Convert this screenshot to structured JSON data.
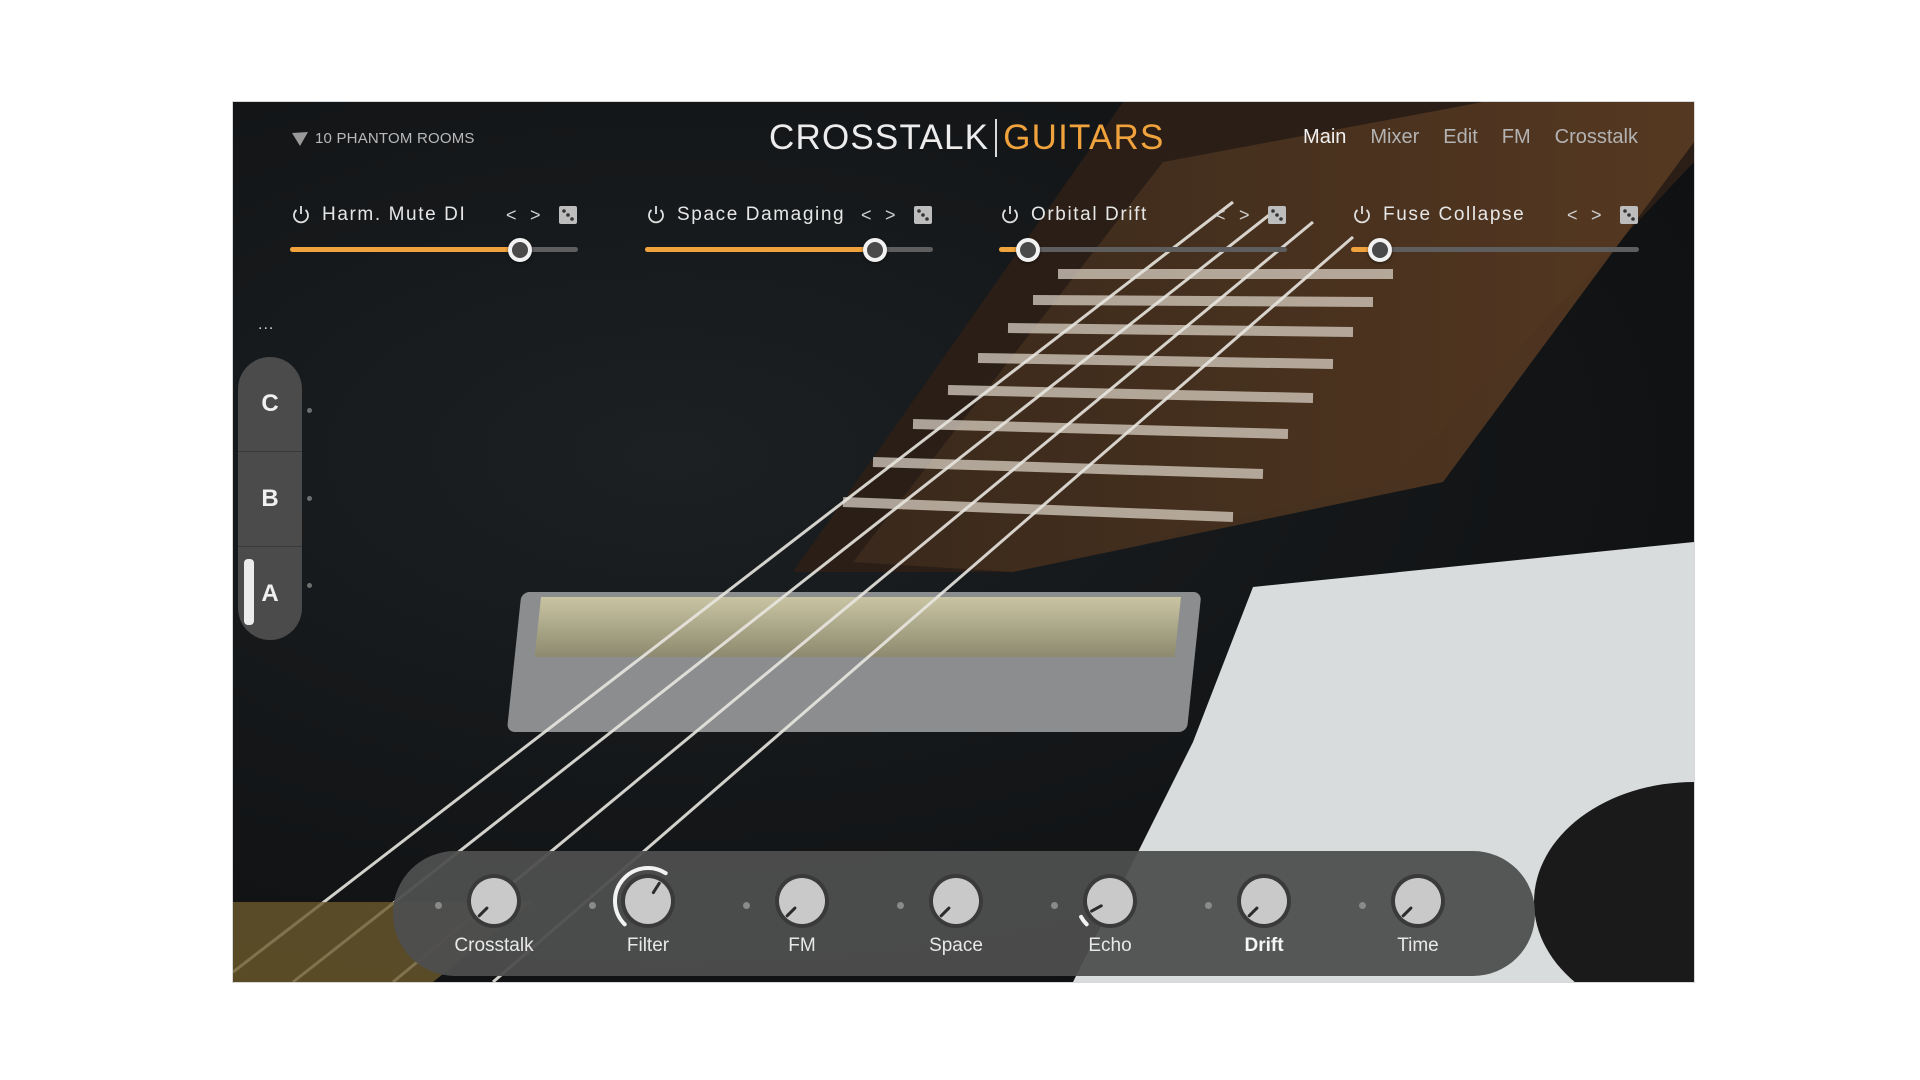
{
  "brand": {
    "logo_icon": "phantom-logo-icon",
    "name": "10 PHANTOM ROOMS"
  },
  "title": {
    "part1": "CROSSTALK",
    "part2": "GUITARS",
    "accent": "#f0a23c"
  },
  "nav": [
    {
      "label": "Main",
      "active": true
    },
    {
      "label": "Mixer",
      "active": false
    },
    {
      "label": "Edit",
      "active": false
    },
    {
      "label": "FM",
      "active": false
    },
    {
      "label": "Crosstalk",
      "active": false
    }
  ],
  "slots": [
    {
      "name": "Harm. Mute DI",
      "value": 0.8,
      "prev": "<",
      "next": ">"
    },
    {
      "name": "Space Damaging",
      "value": 0.8,
      "prev": "<",
      "next": ">"
    },
    {
      "name": "Orbital Drift",
      "value": 0.1,
      "prev": "<",
      "next": ">"
    },
    {
      "name": "Fuse Collapse",
      "value": 0.1,
      "prev": "<",
      "next": ">"
    }
  ],
  "side": {
    "more": "...",
    "buttons": [
      "C",
      "B",
      "A"
    ],
    "active": "A"
  },
  "knobs": [
    {
      "label": "Crosstalk",
      "value": 0.0,
      "ring": false,
      "bold": false
    },
    {
      "label": "Filter",
      "value": 0.62,
      "ring": true,
      "bold": false
    },
    {
      "label": "FM",
      "value": 0.0,
      "ring": false,
      "bold": false
    },
    {
      "label": "Space",
      "value": 0.0,
      "ring": false,
      "bold": false
    },
    {
      "label": "Echo",
      "value": 0.06,
      "ring": true,
      "bold": false
    },
    {
      "label": "Drift",
      "value": 0.0,
      "ring": false,
      "bold": true
    },
    {
      "label": "Time",
      "value": 0.0,
      "ring": false,
      "bold": false
    }
  ]
}
